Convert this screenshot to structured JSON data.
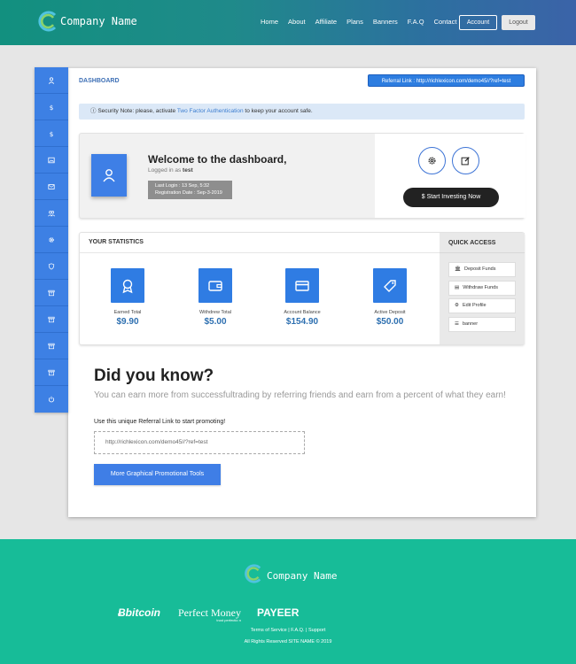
{
  "header": {
    "brand": "Company Name",
    "nav": [
      "Home",
      "About",
      "Affiliate",
      "Plans",
      "Banners",
      "F.A.Q",
      "Contact"
    ],
    "account_label": "Account",
    "logout_label": "Logout"
  },
  "sidebar": {
    "icons": [
      "user-icon",
      "dollar-icon",
      "dollar-icon",
      "image-icon",
      "mail-icon",
      "users-icon",
      "gear-icon",
      "shield-icon",
      "archive-icon",
      "archive-icon",
      "archive-icon",
      "archive-icon",
      "power-icon"
    ]
  },
  "dashboard": {
    "title": "DASHBOARD",
    "referral_link_label": "Referral Link : http://richlexicon.com/demo45//?ref=test",
    "security_note": "Security Note: please, activate",
    "security_link": "Two Factor Authentication",
    "security_note_end": "to keep your account safe."
  },
  "welcome": {
    "title": "Welcome to the dashboard,",
    "logged_prefix": "Logged in as",
    "username": "test",
    "last_login": "Last Login : 13 Sep, 5:32",
    "registration": "Registration Date : Sep-3-2019",
    "invest_label": "Start Investing Now"
  },
  "statistics": {
    "title": "YOUR STATISTICS",
    "items": [
      {
        "label": "Earned Total",
        "value": "$9.90",
        "icon": "award-icon"
      },
      {
        "label": "Withdrew Total",
        "value": "$5.00",
        "icon": "wallet-icon"
      },
      {
        "label": "Account Balance",
        "value": "$154.90",
        "icon": "credit-card-icon"
      },
      {
        "label": "Active Deposit",
        "value": "$50.00",
        "icon": "tag-icon"
      }
    ]
  },
  "quick_access": {
    "title": "QUICK ACCESS",
    "items": [
      {
        "label": "Deposit Funds",
        "icon": "bank-icon"
      },
      {
        "label": "Withdraw Funds",
        "icon": "withdraw-icon"
      },
      {
        "label": "Edit Profile",
        "icon": "gear-icon"
      },
      {
        "label": "banner",
        "icon": "list-icon"
      }
    ]
  },
  "promo": {
    "title": "Did you know?",
    "subtitle": "You can earn more from successfultrading by referring friends and earn from a percent of what they earn!",
    "ref_label": "Use this unique Referral Link to start promoting!",
    "ref_value": "http://richlexicon.com/demo45//?ref=test",
    "button_label": "More Graphical Promotional Tools"
  },
  "footer": {
    "brand": "Company Name",
    "payments": [
      "bitcoin",
      "Perfect Money",
      "PAYEER"
    ],
    "pm_tagline": "trust perfectio n",
    "links": "Terms of Service | F.A.Q. | Support",
    "copyright": "All Rights Reserved SITE NAME © 2019"
  }
}
